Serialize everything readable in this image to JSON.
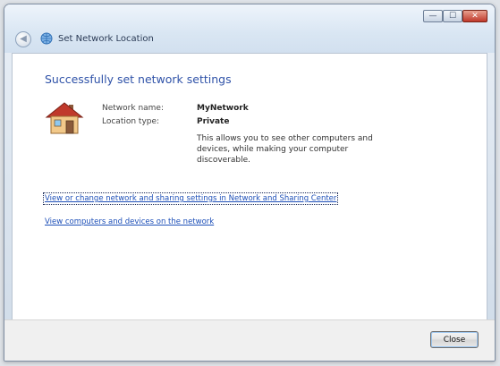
{
  "window": {
    "title": "Set Network Location",
    "controls": {
      "minimize_glyph": "—",
      "maximize_glyph": "☐",
      "close_glyph": "✕"
    },
    "back_glyph": "◀"
  },
  "main": {
    "heading": "Successfully set network settings",
    "network_name_label": "Network name:",
    "network_name_value": "MyNetwork",
    "location_type_label": "Location type:",
    "location_type_value": "Private",
    "description": "This allows you to see other computers and devices, while making your computer discoverable.",
    "links": [
      "View or change network and sharing settings in Network and Sharing Center",
      "View computers and devices on the network"
    ]
  },
  "footer": {
    "close_label": "Close"
  },
  "icons": {
    "title": "network-globe-icon",
    "location": "house-icon",
    "back": "back-arrow-icon"
  },
  "colors": {
    "heading": "#2f52a8",
    "link": "#1d4fb8",
    "close_button_red": "#c0392b"
  }
}
